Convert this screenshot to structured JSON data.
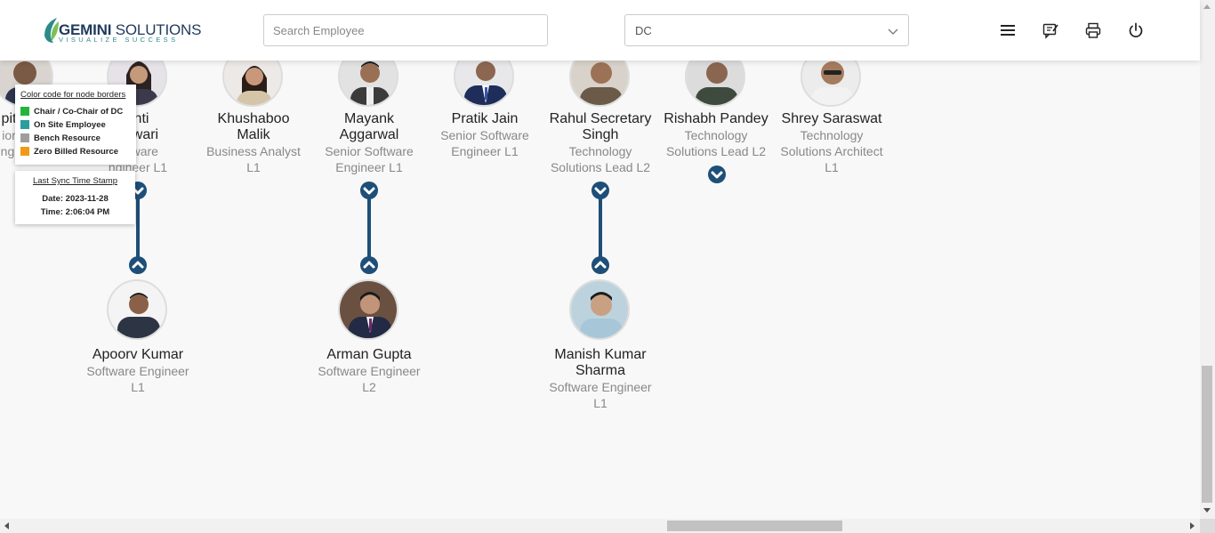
{
  "header": {
    "logo_name_bold": "GEMINI",
    "logo_name_rest": " SOLUTIONS",
    "logo_tagline": "VISUALIZE SUCCESS",
    "search_placeholder": "Search Employee",
    "dc_select_value": "DC",
    "icons": [
      "menu-icon",
      "feedback-icon",
      "print-icon",
      "power-icon"
    ]
  },
  "legend": {
    "title": "Color code for node borders",
    "items": [
      {
        "label": "Chair / Co-Chair of DC",
        "color": "#22b53a"
      },
      {
        "label": "On Site Employee",
        "color": "#2a9d9d"
      },
      {
        "label": "Bench Resource",
        "color": "#9e9e9e"
      },
      {
        "label": "Zero Billed Resource",
        "color": "#f29a16"
      }
    ]
  },
  "sync": {
    "title": "Last Sync Time Stamp",
    "date": "Date: 2023-11-28",
    "time": "Time: 2:06:04 PM"
  },
  "top_row": [
    {
      "name_lines": [
        "pit",
        ""
      ],
      "title_lines": [
        "ior",
        "ngi"
      ]
    },
    {
      "name_lines": [
        "shti",
        "shwari"
      ],
      "title_lines": [
        "oftware",
        "ngineer L1"
      ]
    },
    {
      "name_lines": [
        "Khushaboo",
        "Malik"
      ],
      "title_lines": [
        "Business Analyst",
        "L1"
      ]
    },
    {
      "name_lines": [
        "Mayank",
        "Aggarwal"
      ],
      "title_lines": [
        "Senior Software",
        "Engineer L1"
      ]
    },
    {
      "name_lines": [
        "Pratik Jain",
        ""
      ],
      "title_lines": [
        "Senior Software",
        "Engineer L1"
      ]
    },
    {
      "name_lines": [
        "Rahul Secretary",
        "Singh"
      ],
      "title_lines": [
        "Technology",
        "Solutions Lead L2"
      ]
    },
    {
      "name_lines": [
        "Rishabh Pandey",
        ""
      ],
      "title_lines": [
        "Technology",
        "Solutions Lead L2"
      ]
    },
    {
      "name_lines": [
        "Shrey Saraswat",
        ""
      ],
      "title_lines": [
        "Technology",
        "Solutions Architect",
        "L1"
      ]
    }
  ],
  "bottom_row": [
    {
      "name_lines": [
        "Apoorv Kumar",
        ""
      ],
      "title_lines": [
        "Software Engineer",
        "L1"
      ]
    },
    {
      "name_lines": [
        "Arman Gupta",
        ""
      ],
      "title_lines": [
        "Software Engineer",
        "L2"
      ]
    },
    {
      "name_lines": [
        "Manish Kumar",
        "Sharma"
      ],
      "title_lines": [
        "Software Engineer",
        "L1"
      ]
    }
  ],
  "colors": {
    "accent": "#1d4f78",
    "header_bg": "#ffffff",
    "canvas_bg": "#f8f8f8"
  }
}
